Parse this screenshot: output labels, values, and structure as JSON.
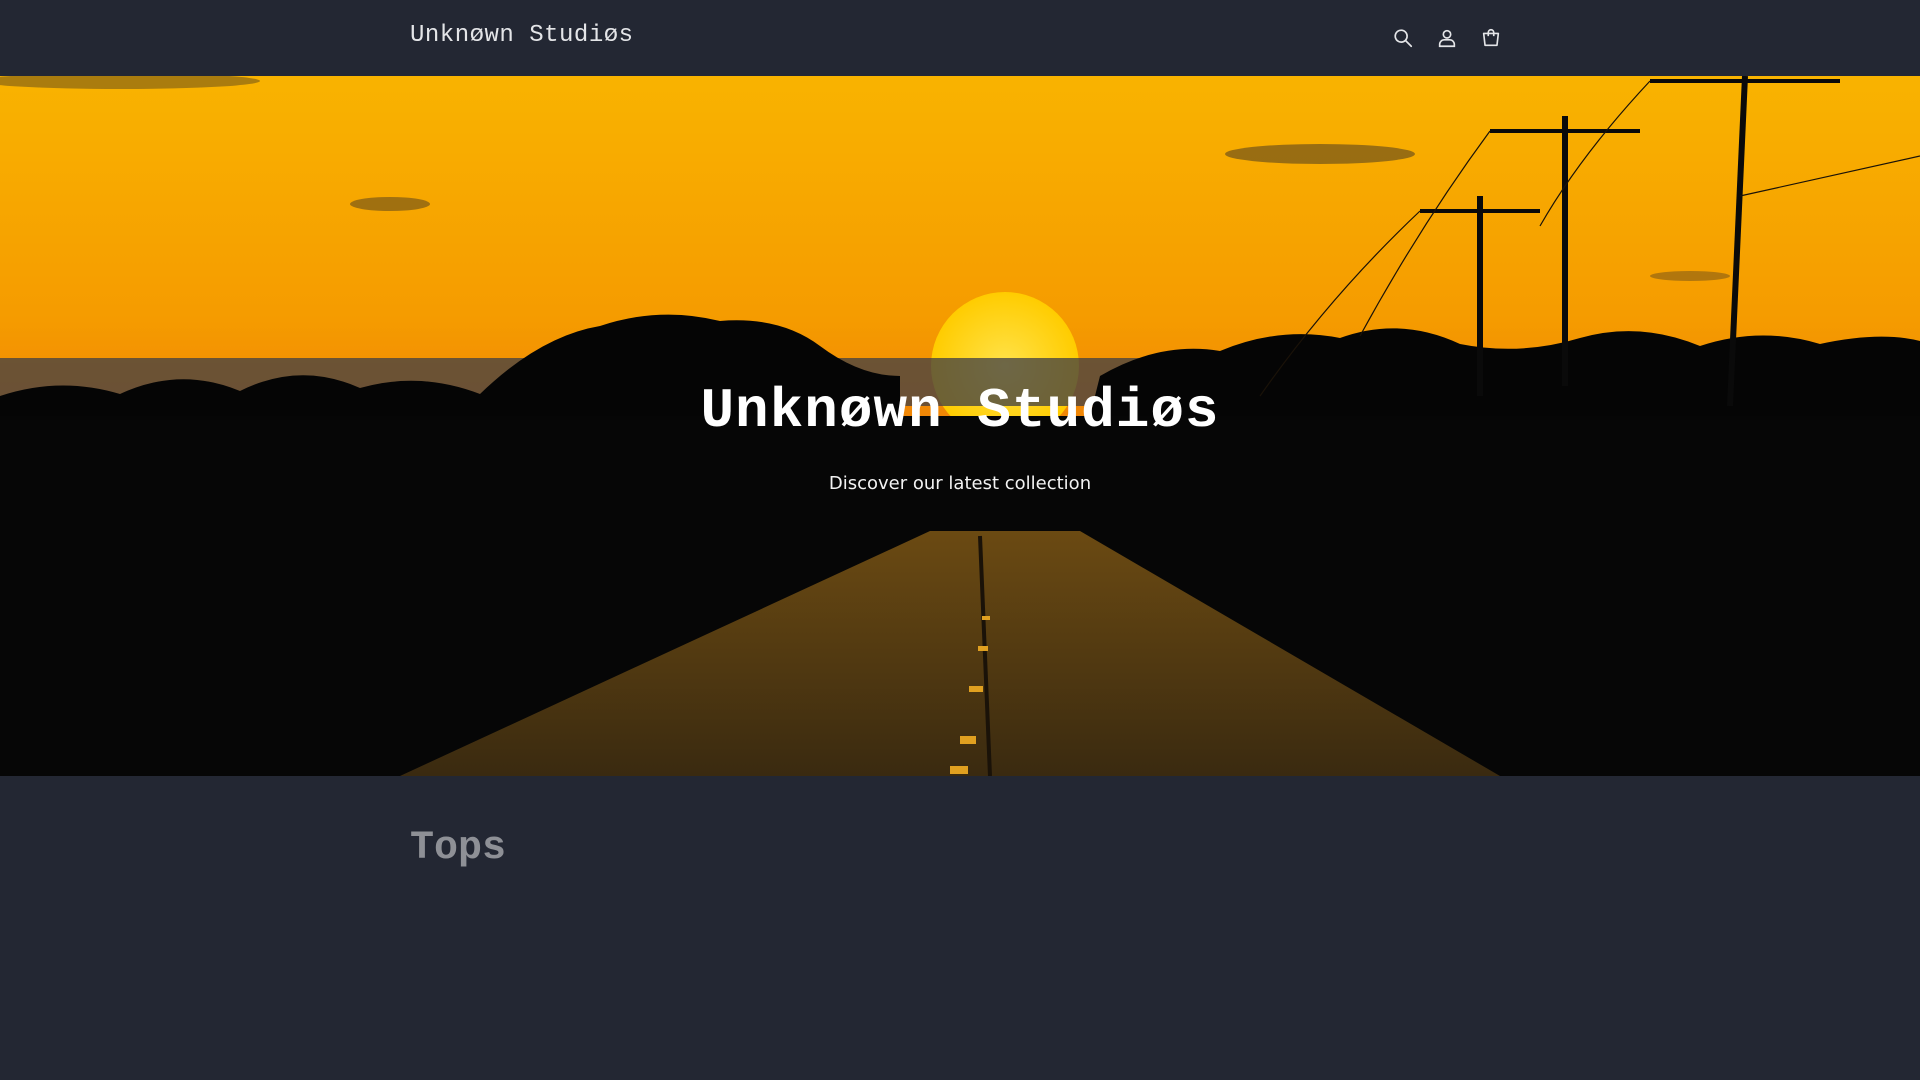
{
  "header": {
    "logo": "Unknøwn Studiøs",
    "icons": [
      "search-icon",
      "account-icon",
      "cart-icon"
    ]
  },
  "hero": {
    "title": "Unknøwn Studiøs",
    "subtitle": "Discover our latest collection"
  },
  "collection": {
    "title": "Tops"
  },
  "colors": {
    "background": "#232733",
    "sky_top": "#f7a800",
    "sky_bottom": "#f07a00",
    "sun": "#ffd500"
  }
}
